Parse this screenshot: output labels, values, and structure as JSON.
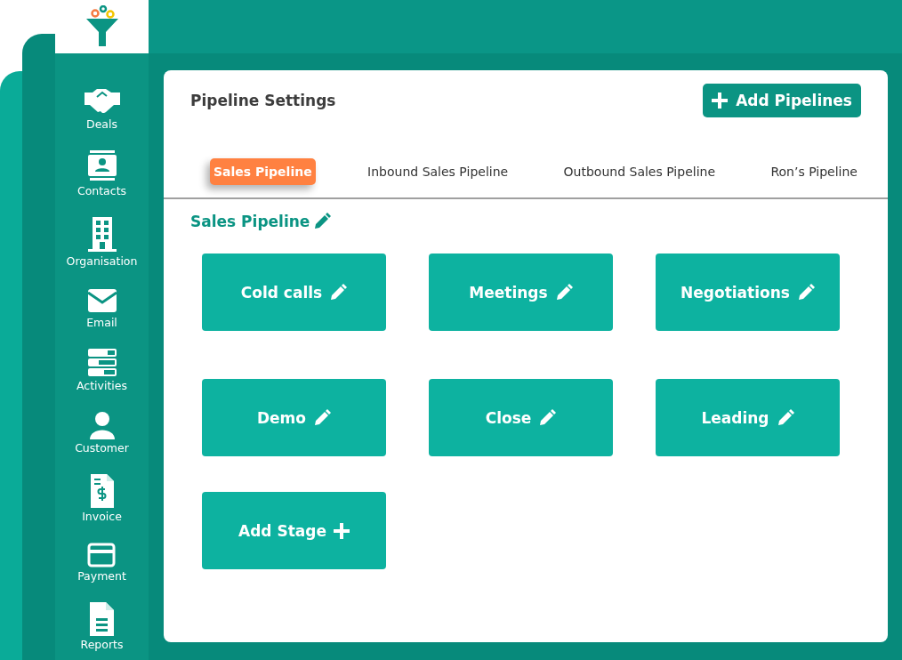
{
  "sidebar": {
    "items": [
      {
        "label": "Deals"
      },
      {
        "label": "Contacts"
      },
      {
        "label": "Organisation"
      },
      {
        "label": "Email"
      },
      {
        "label": "Activities"
      },
      {
        "label": "Customer"
      },
      {
        "label": "Invoice"
      },
      {
        "label": "Payment"
      },
      {
        "label": "Reports"
      }
    ]
  },
  "panel": {
    "title": "Pipeline Settings",
    "add_button": "Add Pipelines",
    "tabs": [
      {
        "label": "Sales Pipeline",
        "selected": true
      },
      {
        "label": "Inbound Sales Pipeline",
        "selected": false
      },
      {
        "label": "Outbound Sales Pipeline",
        "selected": false
      },
      {
        "label": "Ron’s Pipeline",
        "selected": false
      }
    ],
    "pipeline_name": "Sales Pipeline",
    "stages": [
      {
        "label": "Cold calls",
        "kind": "stage"
      },
      {
        "label": "Meetings",
        "kind": "stage"
      },
      {
        "label": "Negotiations",
        "kind": "stage"
      },
      {
        "label": "Demo",
        "kind": "stage"
      },
      {
        "label": "Close",
        "kind": "stage"
      },
      {
        "label": "Leading",
        "kind": "stage"
      },
      {
        "label": "Add Stage",
        "kind": "add"
      }
    ]
  }
}
